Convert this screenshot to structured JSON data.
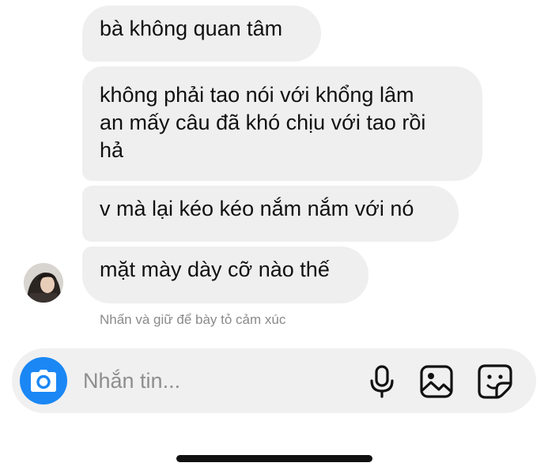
{
  "messages": [
    {
      "text": "bà không quan tâm"
    },
    {
      "line1": "không phải tao nói với khổng lâm",
      "line2": "an mấy câu đã khó chịu với tao rồi",
      "line3": "hả"
    },
    {
      "text": "v mà lại kéo kéo nắm nắm với nó"
    },
    {
      "text": "mặt mày dày cỡ nào thế"
    }
  ],
  "reaction_hint": "Nhấn và giữ để bày tỏ cảm xúc",
  "composer": {
    "placeholder": "Nhắn tin..."
  },
  "icons": {
    "camera": "camera-icon",
    "mic": "microphone-icon",
    "gallery": "image-icon",
    "sticker": "sticker-icon"
  },
  "colors": {
    "bubble_bg": "#efefef",
    "accent": "#1a87f5",
    "hint_text": "#8a8a8a"
  }
}
